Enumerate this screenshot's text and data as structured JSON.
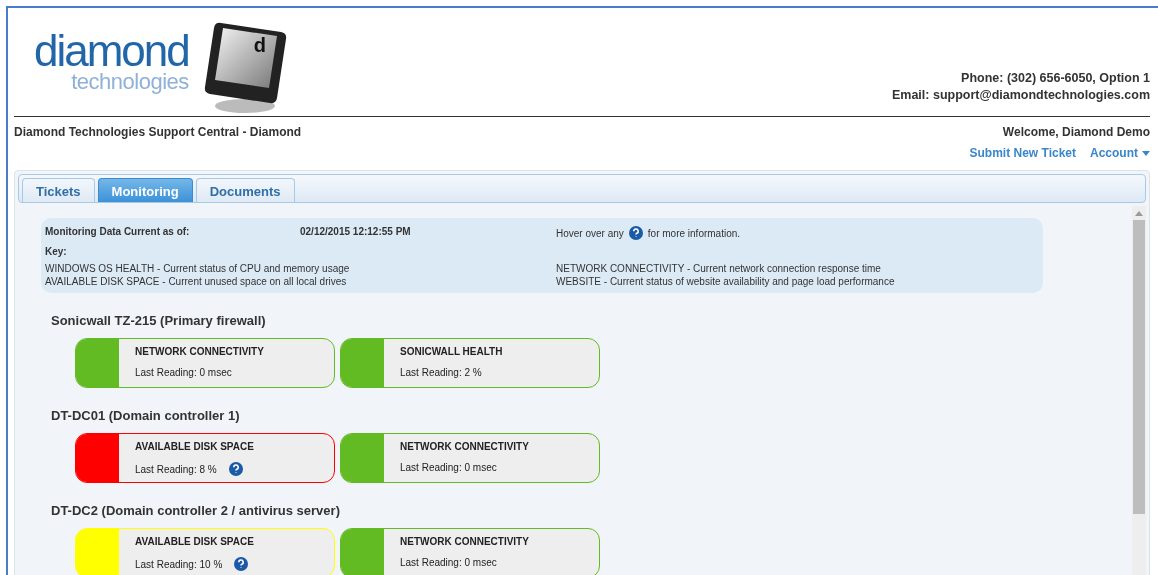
{
  "logo": {
    "word": "diamond",
    "subword": "technologies",
    "key_letter": "d"
  },
  "contact": {
    "phone": "Phone: (302) 656-6050, Option 1",
    "email": "Email: support@diamondtechnologies.com"
  },
  "site_title": "Diamond Technologies Support Central - Diamond",
  "welcome": "Welcome, Diamond Demo",
  "nav_links": [
    {
      "label": "Submit New Ticket",
      "dropdown": false
    },
    {
      "label": "Account",
      "dropdown": true
    }
  ],
  "tabs": [
    {
      "label": "Tickets",
      "selected": false
    },
    {
      "label": "Monitoring",
      "selected": true
    },
    {
      "label": "Documents",
      "selected": false
    }
  ],
  "info": {
    "current_label": "Monitoring Data Current as of:",
    "current_value": "02/12/2015 12:12:55 PM",
    "hover_before": "Hover over any",
    "hover_after": "for more information.",
    "key_label": "Key:",
    "key_items": [
      "WINDOWS OS HEALTH - Current status of CPU and memory usage",
      "NETWORK CONNECTIVITY - Current network connection response time",
      "AVAILABLE DISK SPACE - Current unused space on all local drives",
      "WEBSITE - Current status of website availability and page load performance"
    ]
  },
  "devices": [
    {
      "name": "Sonicwall TZ-215 (Primary firewall)",
      "monitors": [
        {
          "title": "NETWORK CONNECTIVITY",
          "reading": "Last Reading: 0 msec",
          "color": "#62bb23",
          "help": false
        },
        {
          "title": "SONICWALL HEALTH",
          "reading": "Last Reading: 2 %",
          "color": "#62bb23",
          "help": false
        }
      ]
    },
    {
      "name": "DT-DC01 (Domain controller 1)",
      "monitors": [
        {
          "title": "AVAILABLE DISK SPACE",
          "reading": "Last Reading: 8 %",
          "color": "#ff0000",
          "help": true
        },
        {
          "title": "NETWORK CONNECTIVITY",
          "reading": "Last Reading: 0 msec",
          "color": "#62bb23",
          "help": false
        }
      ]
    },
    {
      "name": "DT-DC2 (Domain controller 2 / antivirus server)",
      "monitors": [
        {
          "title": "AVAILABLE DISK SPACE",
          "reading": "Last Reading: 10 %",
          "color": "#ffff00",
          "help": true
        },
        {
          "title": "NETWORK CONNECTIVITY",
          "reading": "Last Reading: 0 msec",
          "color": "#62bb23",
          "help": false
        }
      ]
    }
  ]
}
